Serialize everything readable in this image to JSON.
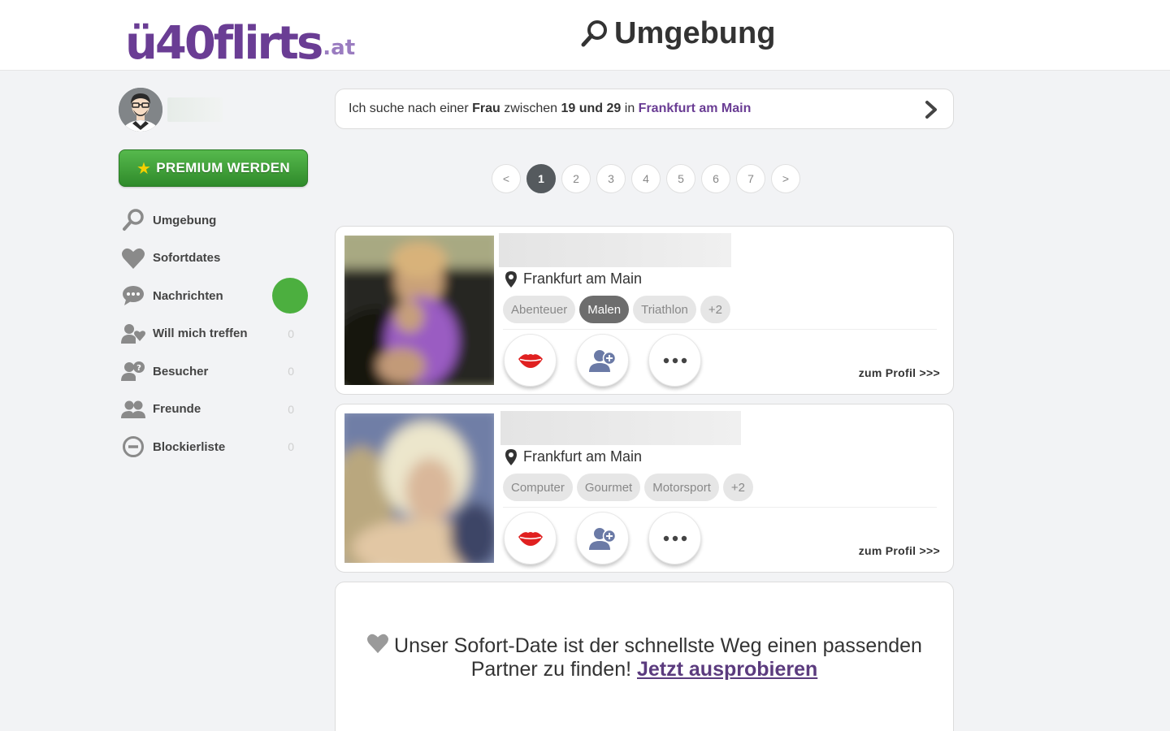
{
  "header": {
    "logo_main": "ü40flirts",
    "logo_tld": ".at",
    "page_title": "Umgebung"
  },
  "sidebar": {
    "premium_label": "PREMIUM WERDEN",
    "items": [
      {
        "label": "Umgebung",
        "icon": "search-icon",
        "count": ""
      },
      {
        "label": "Sofortdates",
        "icon": "heart-icon",
        "count": ""
      },
      {
        "label": "Nachrichten",
        "icon": "chat-icon",
        "count": ""
      },
      {
        "label": "Will mich treffen",
        "icon": "user-heart-icon",
        "count": "0"
      },
      {
        "label": "Besucher",
        "icon": "user-question-icon",
        "count": "0"
      },
      {
        "label": "Freunde",
        "icon": "users-icon",
        "count": "0"
      },
      {
        "label": "Blockierliste",
        "icon": "block-icon",
        "count": "0"
      }
    ],
    "accent_colors": {
      "premium": "#3fa337",
      "online_dot": "#4caf3f"
    }
  },
  "search": {
    "prefix": "Ich suche nach einer",
    "gender": "Frau",
    "between": "zwischen",
    "age_range": "19 und 29",
    "in": "in",
    "city": "Frankfurt am Main"
  },
  "pagination": {
    "prev": "<",
    "next": ">",
    "pages": [
      "1",
      "2",
      "3",
      "4",
      "5",
      "6",
      "7"
    ],
    "current": "1"
  },
  "profiles": [
    {
      "location": "Frankfurt am Main",
      "tags": [
        "Abenteuer",
        "Malen",
        "Triathlon",
        "+2"
      ],
      "link": "zum Profil >>>"
    },
    {
      "location": "Frankfurt am Main",
      "tags": [
        "Computer",
        "Gourmet",
        "Motorsport",
        "+2"
      ],
      "link": "zum Profil >>>"
    }
  ],
  "promo": {
    "text": "Unser Sofort-Date ist der schnellste Weg einen passenden Partner zu finden!",
    "link": "Jetzt ausprobieren"
  },
  "colors": {
    "brand": "#6a3d94",
    "kiss": "#e02020",
    "action_icon": "#6b7aa6"
  }
}
